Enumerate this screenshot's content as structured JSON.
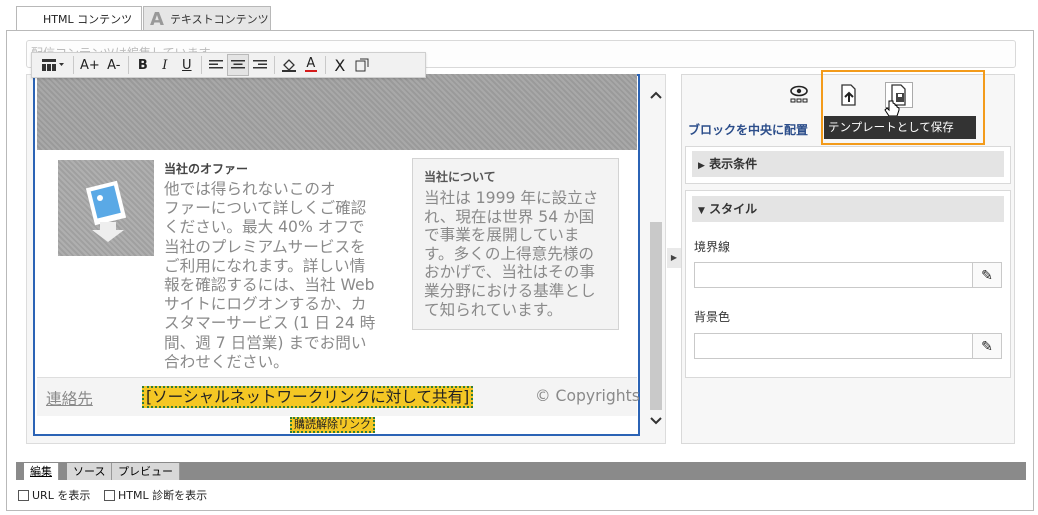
{
  "tabs": [
    {
      "label": "HTML コンテンツ",
      "active": true
    },
    {
      "label": "テキストコンテンツ",
      "active": false
    }
  ],
  "subject_partial": "配信コンテンツは編集しています",
  "toolbar": {
    "buttons": [
      "A+",
      "A-",
      "B",
      "I",
      "U",
      "X"
    ]
  },
  "content": {
    "offer_title": "当社のオファー",
    "offer_text": "他では得られないこのオ\nファーについて詳しくご確認\nください。最大 40% オフで\n当社のプレミアムサービスを\nご利用になれます。詳しい情\n報を確認するには、当社 Web\nサイトにログオンするか、カ\nスタマーサービス (1 日 24 時\n間、週 7 日営業) までお問い\n合わせください。",
    "about_title": "当社について",
    "about_text": "当社は 1999 年に設立さ\nれ、現在は世界 54 か国\nで事業を展開していま\nす。多くの上得意先様の\nおかげで、当社はその事\n業分野における基準とし\nて知られています。",
    "contact": "連絡先",
    "social": "[ソーシャルネットワークリンクに対して共有]",
    "copyright": "© Copyrights",
    "unsubscribe": "購読解除リンク"
  },
  "right_panel": {
    "block_label": "ブロックを中央に配置",
    "tooltip": "テンプレートとして保存",
    "sections": {
      "display_conditions": "表示条件",
      "style": "スタイル"
    },
    "fields": {
      "border_label": "境界線",
      "border_value": "",
      "background_label": "背景色",
      "background_value": ""
    }
  },
  "bottom_tabs": [
    "編集",
    "ソース",
    "プレビュー"
  ],
  "checkboxes": [
    {
      "label": "URL を表示",
      "checked": false
    },
    {
      "label": "HTML 診断を表示",
      "checked": false
    }
  ],
  "colors": {
    "accent_blue": "#2b63b5",
    "highlight_orange": "#f39b1b",
    "personalization_yellow": "#f4c724"
  }
}
